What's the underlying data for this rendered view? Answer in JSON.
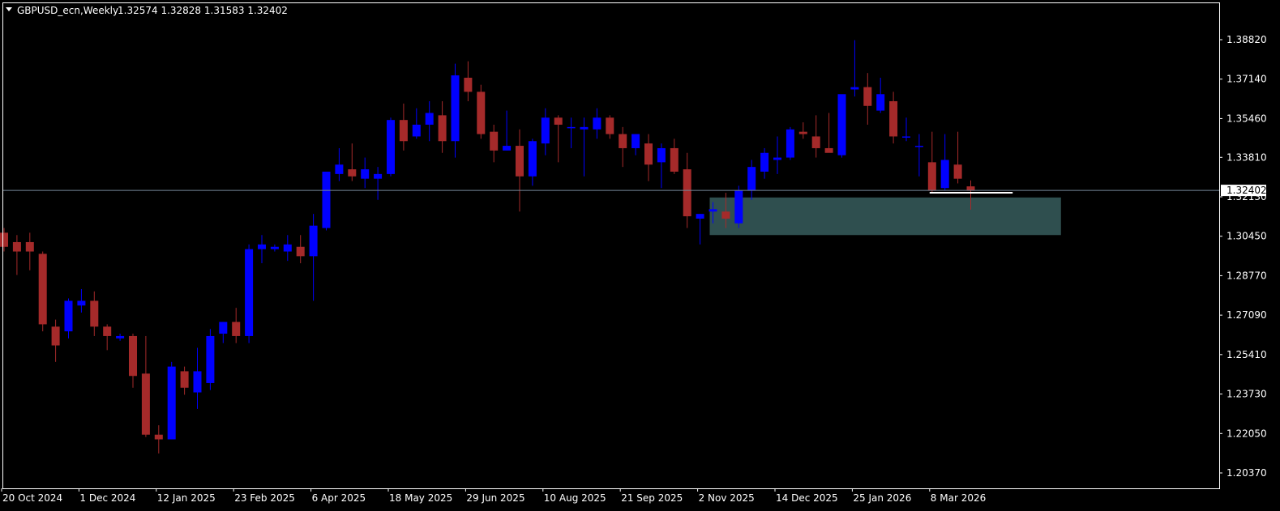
{
  "header": {
    "symbol": "GBPUSD_ecn,Weekly",
    "ohlc": "1.32574 1.32828 1.31583 1.32402"
  },
  "colors": {
    "background": "#000000",
    "frame": "#ffffff",
    "bull": "#0000ff",
    "bear": "#a52a2a",
    "wick": "#a52a2a",
    "price_line": "#778899",
    "zone": "#2f4f4f",
    "level_line": "#ffffff",
    "price_tag_bg": "#ffffff"
  },
  "current_price_label": "1.32402",
  "chart_data": {
    "type": "candlestick",
    "title": "GBPUSD_ecn,Weekly",
    "ylim": [
      1.195,
      1.403
    ],
    "y_ticks": [
      "1.38820",
      "1.37140",
      "1.35460",
      "1.33810",
      "1.32130",
      "1.30450",
      "1.28770",
      "1.27090",
      "1.25410",
      "1.23730",
      "1.22050",
      "1.20370"
    ],
    "x_ticks": [
      {
        "label": "20 Oct 2024",
        "index": 0
      },
      {
        "label": "1 Dec 2024",
        "index": 6
      },
      {
        "label": "12 Jan 2025",
        "index": 12
      },
      {
        "label": "23 Feb 2025",
        "index": 18
      },
      {
        "label": "6 Apr 2025",
        "index": 24
      },
      {
        "label": "18 May 2025",
        "index": 30
      },
      {
        "label": "29 Jun 2025",
        "index": 36
      },
      {
        "label": "10 Aug 2025",
        "index": 42
      },
      {
        "label": "21 Sep 2025",
        "index": 48
      },
      {
        "label": "2 Nov 2025",
        "index": 54
      },
      {
        "label": "14 Dec 2025",
        "index": 60
      },
      {
        "label": "25 Jan 2026",
        "index": 66
      },
      {
        "label": "8 Mar 2026",
        "index": 72
      }
    ],
    "current_price": 1.32402,
    "candles": [
      {
        "o": 1.306,
        "h": 1.308,
        "l": 1.298,
        "c": 1.3
      },
      {
        "o": 1.302,
        "h": 1.305,
        "l": 1.288,
        "c": 1.298
      },
      {
        "o": 1.302,
        "h": 1.306,
        "l": 1.29,
        "c": 1.298
      },
      {
        "o": 1.297,
        "h": 1.298,
        "l": 1.264,
        "c": 1.267
      },
      {
        "o": 1.266,
        "h": 1.269,
        "l": 1.251,
        "c": 1.258
      },
      {
        "o": 1.264,
        "h": 1.278,
        "l": 1.261,
        "c": 1.277
      },
      {
        "o": 1.275,
        "h": 1.282,
        "l": 1.272,
        "c": 1.277
      },
      {
        "o": 1.277,
        "h": 1.281,
        "l": 1.262,
        "c": 1.266
      },
      {
        "o": 1.266,
        "h": 1.267,
        "l": 1.256,
        "c": 1.262
      },
      {
        "o": 1.261,
        "h": 1.263,
        "l": 1.26,
        "c": 1.262
      },
      {
        "o": 1.262,
        "h": 1.263,
        "l": 1.24,
        "c": 1.245
      },
      {
        "o": 1.246,
        "h": 1.262,
        "l": 1.219,
        "c": 1.22
      },
      {
        "o": 1.22,
        "h": 1.224,
        "l": 1.212,
        "c": 1.218
      },
      {
        "o": 1.218,
        "h": 1.251,
        "l": 1.218,
        "c": 1.249
      },
      {
        "o": 1.247,
        "h": 1.249,
        "l": 1.237,
        "c": 1.24
      },
      {
        "o": 1.238,
        "h": 1.257,
        "l": 1.231,
        "c": 1.247
      },
      {
        "o": 1.242,
        "h": 1.265,
        "l": 1.239,
        "c": 1.262
      },
      {
        "o": 1.263,
        "h": 1.268,
        "l": 1.259,
        "c": 1.268
      },
      {
        "o": 1.268,
        "h": 1.274,
        "l": 1.259,
        "c": 1.262
      },
      {
        "o": 1.262,
        "h": 1.301,
        "l": 1.259,
        "c": 1.299
      },
      {
        "o": 1.299,
        "h": 1.305,
        "l": 1.293,
        "c": 1.301
      },
      {
        "o": 1.299,
        "h": 1.301,
        "l": 1.298,
        "c": 1.3
      },
      {
        "o": 1.298,
        "h": 1.305,
        "l": 1.294,
        "c": 1.301
      },
      {
        "o": 1.3,
        "h": 1.305,
        "l": 1.293,
        "c": 1.296
      },
      {
        "o": 1.296,
        "h": 1.314,
        "l": 1.277,
        "c": 1.309
      },
      {
        "o": 1.308,
        "h": 1.331,
        "l": 1.307,
        "c": 1.332
      },
      {
        "o": 1.331,
        "h": 1.342,
        "l": 1.328,
        "c": 1.335
      },
      {
        "o": 1.333,
        "h": 1.344,
        "l": 1.328,
        "c": 1.33
      },
      {
        "o": 1.329,
        "h": 1.338,
        "l": 1.325,
        "c": 1.333
      },
      {
        "o": 1.329,
        "h": 1.334,
        "l": 1.32,
        "c": 1.331
      },
      {
        "o": 1.331,
        "h": 1.355,
        "l": 1.33,
        "c": 1.354
      },
      {
        "o": 1.354,
        "h": 1.361,
        "l": 1.341,
        "c": 1.345
      },
      {
        "o": 1.347,
        "h": 1.359,
        "l": 1.346,
        "c": 1.352
      },
      {
        "o": 1.352,
        "h": 1.362,
        "l": 1.345,
        "c": 1.357
      },
      {
        "o": 1.356,
        "h": 1.362,
        "l": 1.34,
        "c": 1.345
      },
      {
        "o": 1.345,
        "h": 1.378,
        "l": 1.338,
        "c": 1.373
      },
      {
        "o": 1.372,
        "h": 1.379,
        "l": 1.362,
        "c": 1.366
      },
      {
        "o": 1.366,
        "h": 1.369,
        "l": 1.346,
        "c": 1.348
      },
      {
        "o": 1.349,
        "h": 1.352,
        "l": 1.336,
        "c": 1.341
      },
      {
        "o": 1.341,
        "h": 1.358,
        "l": 1.341,
        "c": 1.343
      },
      {
        "o": 1.343,
        "h": 1.35,
        "l": 1.315,
        "c": 1.33
      },
      {
        "o": 1.33,
        "h": 1.346,
        "l": 1.326,
        "c": 1.345
      },
      {
        "o": 1.344,
        "h": 1.359,
        "l": 1.339,
        "c": 1.355
      },
      {
        "o": 1.355,
        "h": 1.356,
        "l": 1.336,
        "c": 1.352
      },
      {
        "o": 1.351,
        "h": 1.355,
        "l": 1.342,
        "c": 1.351
      },
      {
        "o": 1.35,
        "h": 1.355,
        "l": 1.33,
        "c": 1.351
      },
      {
        "o": 1.35,
        "h": 1.359,
        "l": 1.346,
        "c": 1.355
      },
      {
        "o": 1.355,
        "h": 1.356,
        "l": 1.346,
        "c": 1.348
      },
      {
        "o": 1.348,
        "h": 1.351,
        "l": 1.334,
        "c": 1.342
      },
      {
        "o": 1.342,
        "h": 1.348,
        "l": 1.339,
        "c": 1.348
      },
      {
        "o": 1.344,
        "h": 1.348,
        "l": 1.328,
        "c": 1.335
      },
      {
        "o": 1.336,
        "h": 1.344,
        "l": 1.325,
        "c": 1.342
      },
      {
        "o": 1.342,
        "h": 1.346,
        "l": 1.331,
        "c": 1.332
      },
      {
        "o": 1.333,
        "h": 1.34,
        "l": 1.308,
        "c": 1.313
      },
      {
        "o": 1.312,
        "h": 1.314,
        "l": 1.301,
        "c": 1.314
      },
      {
        "o": 1.315,
        "h": 1.319,
        "l": 1.31,
        "c": 1.316
      },
      {
        "o": 1.315,
        "h": 1.323,
        "l": 1.308,
        "c": 1.312
      },
      {
        "o": 1.31,
        "h": 1.326,
        "l": 1.308,
        "c": 1.324
      },
      {
        "o": 1.324,
        "h": 1.337,
        "l": 1.32,
        "c": 1.334
      },
      {
        "o": 1.332,
        "h": 1.342,
        "l": 1.329,
        "c": 1.34
      },
      {
        "o": 1.337,
        "h": 1.347,
        "l": 1.331,
        "c": 1.338
      },
      {
        "o": 1.338,
        "h": 1.351,
        "l": 1.337,
        "c": 1.35
      },
      {
        "o": 1.349,
        "h": 1.353,
        "l": 1.346,
        "c": 1.348
      },
      {
        "o": 1.347,
        "h": 1.356,
        "l": 1.338,
        "c": 1.342
      },
      {
        "o": 1.342,
        "h": 1.357,
        "l": 1.341,
        "c": 1.34
      },
      {
        "o": 1.339,
        "h": 1.364,
        "l": 1.338,
        "c": 1.365
      },
      {
        "o": 1.367,
        "h": 1.388,
        "l": 1.364,
        "c": 1.368
      },
      {
        "o": 1.368,
        "h": 1.374,
        "l": 1.352,
        "c": 1.36
      },
      {
        "o": 1.358,
        "h": 1.372,
        "l": 1.357,
        "c": 1.365
      },
      {
        "o": 1.362,
        "h": 1.366,
        "l": 1.344,
        "c": 1.347
      },
      {
        "o": 1.347,
        "h": 1.355,
        "l": 1.345,
        "c": 1.347
      },
      {
        "o": 1.343,
        "h": 1.348,
        "l": 1.33,
        "c": 1.343
      },
      {
        "o": 1.336,
        "h": 1.349,
        "l": 1.323,
        "c": 1.324
      },
      {
        "o": 1.325,
        "h": 1.348,
        "l": 1.324,
        "c": 1.337
      },
      {
        "o": 1.335,
        "h": 1.349,
        "l": 1.327,
        "c": 1.329
      },
      {
        "o": 1.32574,
        "h": 1.32828,
        "l": 1.31583,
        "c": 1.32402
      }
    ],
    "demand_zone": {
      "from_index": 55,
      "to_index": 82,
      "top": 1.321,
      "bottom": 1.305
    },
    "support_line": {
      "from_index": 72,
      "to_index": 78,
      "price": 1.323
    }
  }
}
